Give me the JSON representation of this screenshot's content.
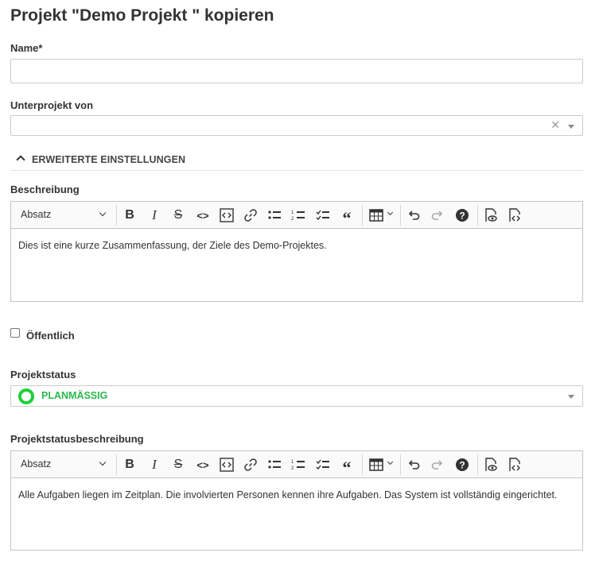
{
  "page": {
    "title": "Projekt \"Demo Projekt \" kopieren"
  },
  "form": {
    "name_label": "Name*",
    "name_value": "",
    "parent_label": "Unterprojekt von",
    "parent_value": "",
    "advanced_label": "ERWEITERTE EINSTELLUNGEN",
    "description_label": "Beschreibung",
    "description_text": "Dies ist eine kurze Zusammenfassung, der Ziele des Demo-Projektes.",
    "public_label": "Öffentlich",
    "public_checked": false,
    "status_label": "Projektstatus",
    "status_value": "PLANMÄSSIG",
    "status_color": "#1dd13a",
    "status_desc_label": "Projektstatusbeschreibung",
    "status_desc_text": "Alle Aufgaben liegen im Zeitplan. Die involvierten Personen kennen ihre Aufgaben. Das System ist vollständig eingerichtet."
  },
  "editor_toolbar": {
    "paragraph_label": "Absatz",
    "icons": [
      "bold-icon",
      "italic-icon",
      "strikethrough-icon",
      "code-icon",
      "code-block-icon",
      "link-icon",
      "bulleted-list-icon",
      "numbered-list-icon",
      "todo-list-icon",
      "blockquote-icon",
      "table-icon",
      "undo-icon",
      "redo-icon",
      "help-icon",
      "preview-icon",
      "source-icon"
    ]
  }
}
